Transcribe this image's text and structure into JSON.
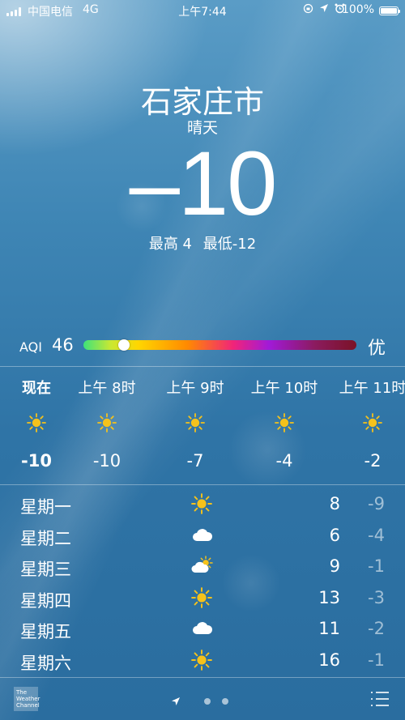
{
  "status_bar": {
    "carrier": "中国电信",
    "network": "4G",
    "time": "上午7:44",
    "icons": [
      "lock-rotation-icon",
      "location-icon",
      "alarm-icon"
    ],
    "battery": "100%",
    "battery_level": 1.0
  },
  "weather": {
    "city": "石家庄市",
    "condition": "晴天",
    "temperature": "–10",
    "high": "最高 4",
    "low": "最低-12"
  },
  "aqi": {
    "label": "AQI",
    "value": "46",
    "level": "优",
    "position_fraction": 0.12
  },
  "hourly": [
    {
      "label": "现在",
      "icon": "sun-icon",
      "temp": "-10",
      "bold": true
    },
    {
      "label": "上午 8时",
      "icon": "sun-icon",
      "temp": "-10",
      "bold": false
    },
    {
      "label": "上午 9时",
      "icon": "sun-icon",
      "temp": "-7",
      "bold": false
    },
    {
      "label": "上午 10时",
      "icon": "sun-icon",
      "temp": "-4",
      "bold": false
    },
    {
      "label": "上午 11时",
      "icon": "sun-icon",
      "temp": "-2",
      "bold": false
    }
  ],
  "daily": [
    {
      "day": "星期一",
      "icon": "sun-icon",
      "high": "8",
      "low": "-9"
    },
    {
      "day": "星期二",
      "icon": "cloud-icon",
      "high": "6",
      "low": "-4"
    },
    {
      "day": "星期三",
      "icon": "partly-cloudy-icon",
      "high": "9",
      "low": "-1"
    },
    {
      "day": "星期四",
      "icon": "sun-icon",
      "high": "13",
      "low": "-3"
    },
    {
      "day": "星期五",
      "icon": "cloud-icon",
      "high": "11",
      "low": "-2"
    },
    {
      "day": "星期六",
      "icon": "sun-icon",
      "high": "16",
      "low": "-1"
    }
  ],
  "bottom_bar": {
    "logo_text": [
      "The",
      "Weather",
      "Channel"
    ],
    "page_count": 2,
    "icons": [
      "location-arrow-icon",
      "list-icon"
    ]
  },
  "colors": {
    "sun": "#f5c21b",
    "background_top": "#5a9cc6",
    "background_bottom": "#2a6d9f"
  }
}
